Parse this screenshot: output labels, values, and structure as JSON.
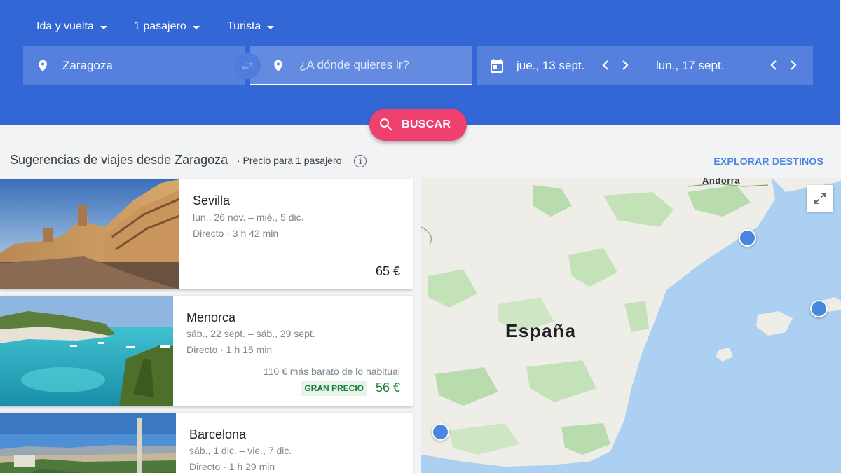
{
  "header": {
    "trip_type": "Ida y vuelta",
    "passengers": "1 pasajero",
    "cabin": "Turista",
    "origin": "Zaragoza",
    "destination_placeholder": "¿A dónde quieres ir?",
    "depart_date": "jue., 13 sept.",
    "return_date": "lun., 17 sept.",
    "search_label": "BUSCAR"
  },
  "suggestions": {
    "title": "Sugerencias de viajes desde Zaragoza",
    "subtitle": "· Precio para 1 pasajero",
    "explore_label": "EXPLORAR DESTINOS",
    "cards": [
      {
        "city": "Sevilla",
        "dates": "lun., 26 nov. – mié., 5 dic.",
        "duration": "Directo · 3 h 42 min",
        "price": "65 €"
      },
      {
        "city": "Menorca",
        "dates": "sáb., 22 sept. – sáb., 29 sept.",
        "duration": "Directo · 1 h 15 min",
        "note": "110 € más barato de lo habitual",
        "badge": "GRAN PRECIO",
        "price": "56 €"
      },
      {
        "city": "Barcelona",
        "dates": "sáb., 1 dic. – vie., 7 dic.",
        "duration": "Directo · 1 h 29 min"
      }
    ]
  },
  "map": {
    "country_label": "España",
    "andorra_label": "Andorra"
  },
  "colors": {
    "header_blue": "#3467d6",
    "search_pink": "#f0406e",
    "link_blue": "#4a86e0",
    "deal_green": "#188038"
  }
}
